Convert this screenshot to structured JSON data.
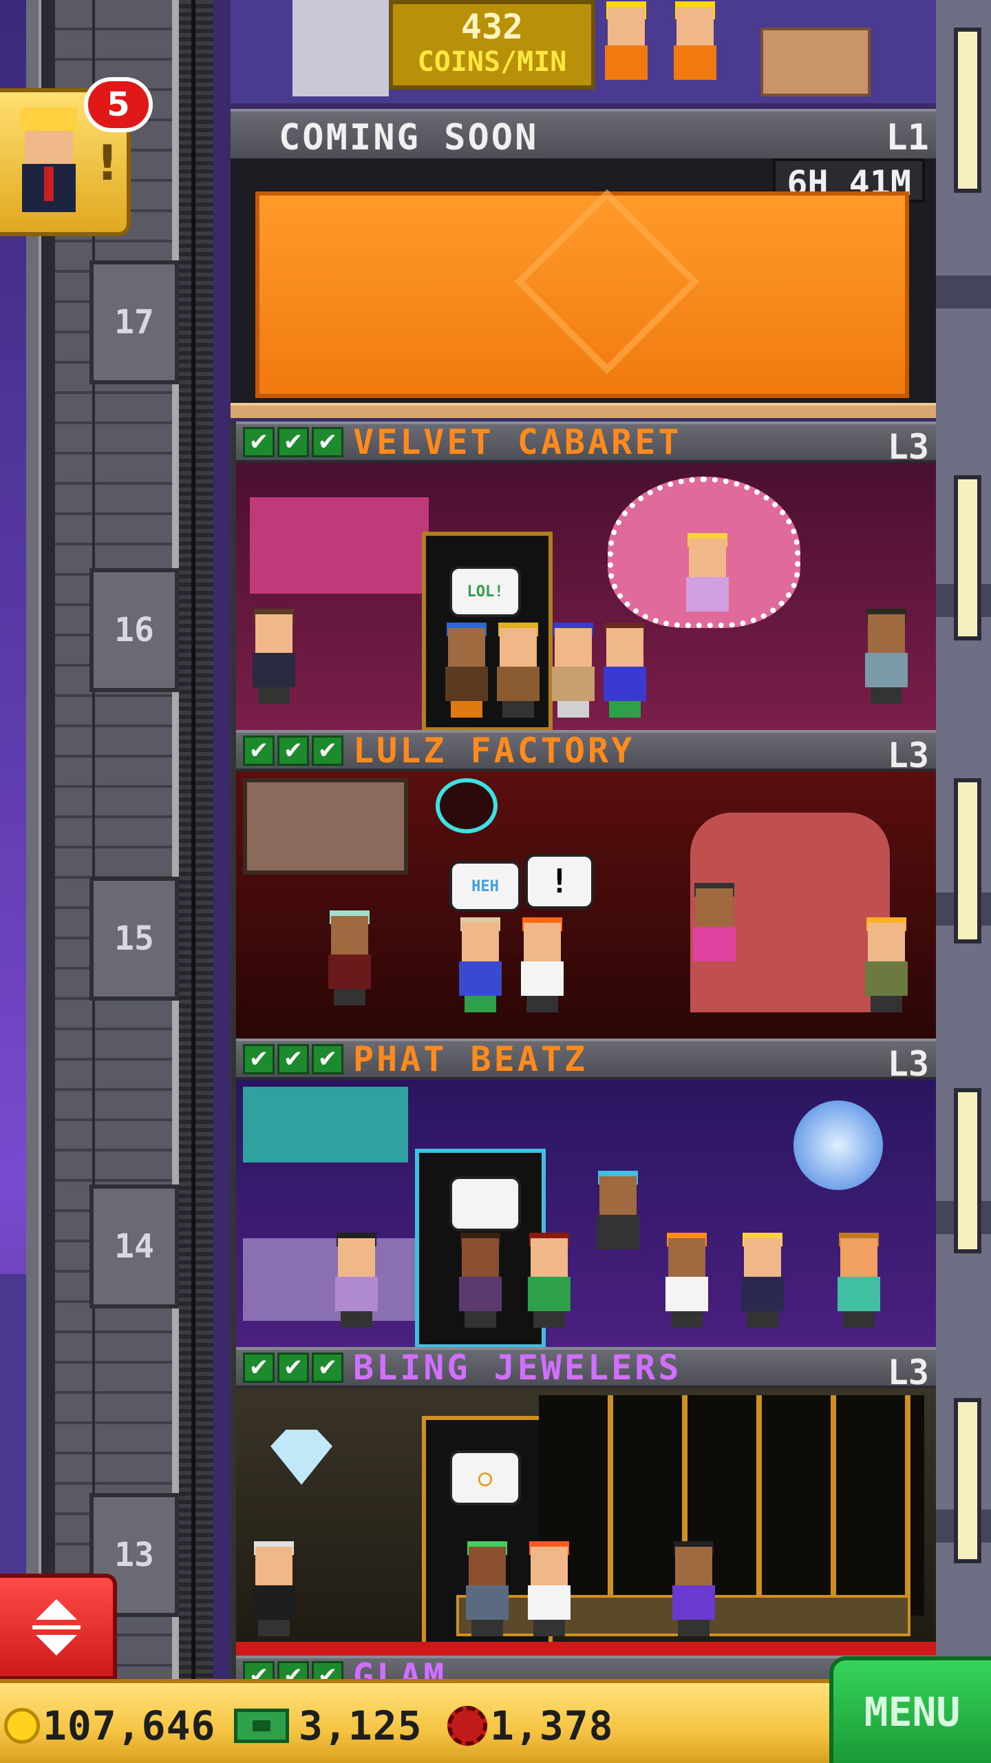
{
  "top_floor": {
    "coins_amount": "432",
    "coins_unit": "COINS/MIN"
  },
  "coming_soon": {
    "title": "COMING SOON",
    "level": "L1",
    "timer": "6H 41M"
  },
  "floor_numbers": [
    "17",
    "16",
    "15",
    "14",
    "13"
  ],
  "floors": [
    {
      "name": "VELVET CABARET",
      "level": "L3",
      "name_color": "#ff8a1e",
      "bubble": "LOL!"
    },
    {
      "name": "LULZ FACTORY",
      "level": "L3",
      "name_color": "#ff8a1e",
      "bubble": "HEH"
    },
    {
      "name": "PHAT BEATZ",
      "level": "L3",
      "name_color": "#ff8a1e",
      "bubble": ""
    },
    {
      "name": "BLING JEWELERS",
      "level": "L3",
      "name_color": "#d070ff",
      "bubble": ""
    }
  ],
  "partial_floor": {
    "name": "GLAM"
  },
  "check_mark": "✔",
  "visitor_badge": {
    "count": "5",
    "icon": "visitor-vip-icon"
  },
  "resources": {
    "coins": "107,646",
    "cash": "3,125",
    "chips": "1,378"
  },
  "menu_label": "MENU"
}
